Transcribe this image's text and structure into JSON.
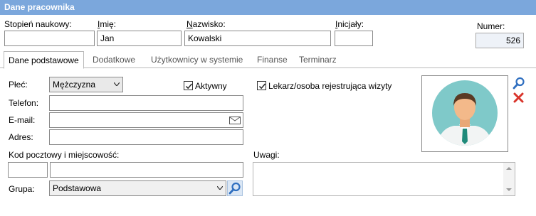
{
  "window": {
    "title": "Dane pracownika"
  },
  "header": {
    "degree_label": "Stopień naukowy:",
    "degree_value": "",
    "firstname_label_u": "I",
    "firstname_label_rest": "mię:",
    "firstname_value": "Jan",
    "lastname_label_u": "N",
    "lastname_label_rest": "azwisko:",
    "lastname_value": "Kowalski",
    "initials_label_u": "I",
    "initials_label_rest": "nicjały:",
    "initials_value": "",
    "number_label": "Numer:",
    "number_value": "526"
  },
  "tabs": [
    {
      "label": "Dane podstawowe"
    },
    {
      "label": "Dodatkowe"
    },
    {
      "label": "Użytkownicy w systemie"
    },
    {
      "label": "Finanse"
    },
    {
      "label": "Terminarz"
    }
  ],
  "form": {
    "gender_label": "Płeć:",
    "gender_value": "Mężczyzna",
    "active_label": "Aktywny",
    "active_checked": true,
    "doctor_label": "Lekarz/osoba rejestrująca wizyty",
    "doctor_checked": true,
    "phone_label": "Telefon:",
    "phone_value": "",
    "email_label": "E-mail:",
    "email_value": "",
    "address_label": "Adres:",
    "address_value": "",
    "postal_label": "Kod pocztowy i miejscowość:",
    "postal_value": "",
    "city_value": "",
    "group_label": "Grupa:",
    "group_value": "Podstawowa",
    "notes_label": "Uwagi:",
    "notes_value": ""
  },
  "colors": {
    "titlebar": "#7ba7dc",
    "avatar_bg": "#7fc9c9",
    "delete_icon": "#d9342b",
    "search_icon": "#2f6fc0"
  }
}
